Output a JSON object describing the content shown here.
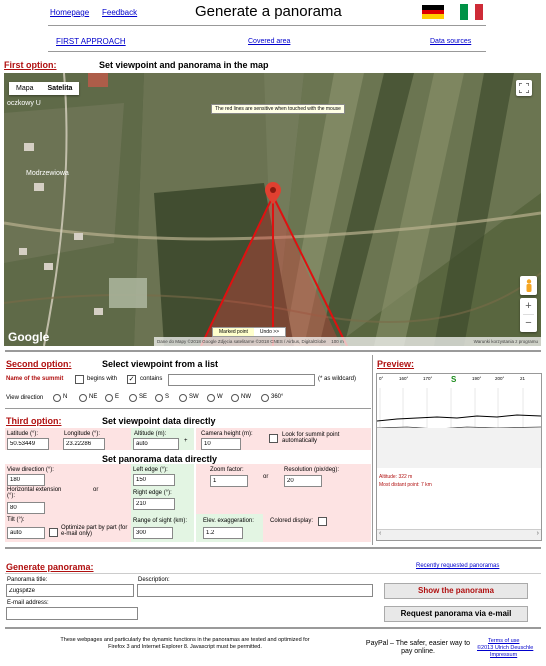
{
  "top": {
    "homepage": "Homepage",
    "feedback": "Feedback",
    "title": "Generate a panorama"
  },
  "nav": {
    "first_approach": "FIRST APPROACH",
    "covered_area": "Covered area",
    "data_sources": "Data sources"
  },
  "first": {
    "label": "First option:",
    "heading": "Set viewpoint and panorama in the map",
    "map_tab": "Mapa",
    "satellite_tab": "Satelita",
    "tooltip": "The red lines are sensitive when touched with the mouse",
    "place_label": "Modrzewiowa",
    "place_label2": "oczkowy U",
    "marker_label": "Marked point",
    "undo_label": "Undo >>",
    "google_logo": "Google",
    "attribution": "Dane do Mapy ©2018 Google Zdjęcia satelitarne ©2018 CNES / Airbus, DigitalGlobe",
    "scale": "100 m",
    "terms": "Warunki korzystania z programu"
  },
  "second": {
    "label": "Second option:",
    "heading": "Select viewpoint from a list",
    "summit_label": "Name of the summit",
    "begins_with": "begins with",
    "contains": "contains",
    "wildcard_note": "(* as wildcard)",
    "view_direction": "View direction",
    "directions": [
      "N",
      "NE",
      "E",
      "SE",
      "S",
      "SW",
      "W",
      "NW",
      "360°"
    ]
  },
  "preview": {
    "label": "Preview:",
    "ticks": [
      "0°",
      "160°",
      "170°",
      "180°",
      "190°",
      "200°",
      "21"
    ],
    "altitude": "Altitude: 322 m",
    "distant": "Most distant point: 7 km"
  },
  "third": {
    "label": "Third option:",
    "heading": "Set viewpoint data directly",
    "latitude_label": "Latitude (°):",
    "latitude": "50.53449",
    "longitude_label": "Longitude (°):",
    "longitude": "23.22286",
    "altitude_label": "Altitude (m):",
    "altitude": "auto",
    "camera_label": "Camera height (m):",
    "camera": "10",
    "look_summit": "Look for summit point automatically",
    "panorama_heading": "Set panorama data directly",
    "view_dir_label": "View direction (°):",
    "view_dir": "180",
    "h_ext_label": "Horizontal extension (°):",
    "h_ext": "80",
    "or1": "or",
    "left_edge_label": "Left edge (°):",
    "left_edge": "150",
    "right_edge_label": "Right edge (°):",
    "right_edge": "210",
    "zoom_label": "Zoom factor:",
    "zoom": "1",
    "or2": "or",
    "resolution_label": "Resolution (pix/deg):",
    "resolution": "20",
    "tilt_label": "Tilt (°):",
    "tilt": "auto",
    "optimize": "Optimize part by part (for e-mail only)",
    "range_label": "Range of sight (km):",
    "range": "300",
    "elev_label": "Elev. exaggeration:",
    "elev": "1.2",
    "colored": "Colored display:"
  },
  "generate": {
    "label": "Generate panorama:",
    "recent": "Recently requested panoramas",
    "title_label": "Panorama title:",
    "title_value": "Zugspitze",
    "desc_label": "Description:",
    "email_label": "E-mail address:",
    "show_btn": "Show the panorama",
    "request_btn": "Request panorama via e-mail"
  },
  "footer": {
    "note": "These webpages and particularly the dynamic functions in the panoramas are tested and optimized for Firefox 3 and Internet Explorer 8. Javascript must be permitted.",
    "paypal": "PayPal – The safer, easier way to pay online.",
    "terms": "Terms of use",
    "copyright": "©2013 Ulrich Deuschle",
    "imprint": "Impressum"
  }
}
